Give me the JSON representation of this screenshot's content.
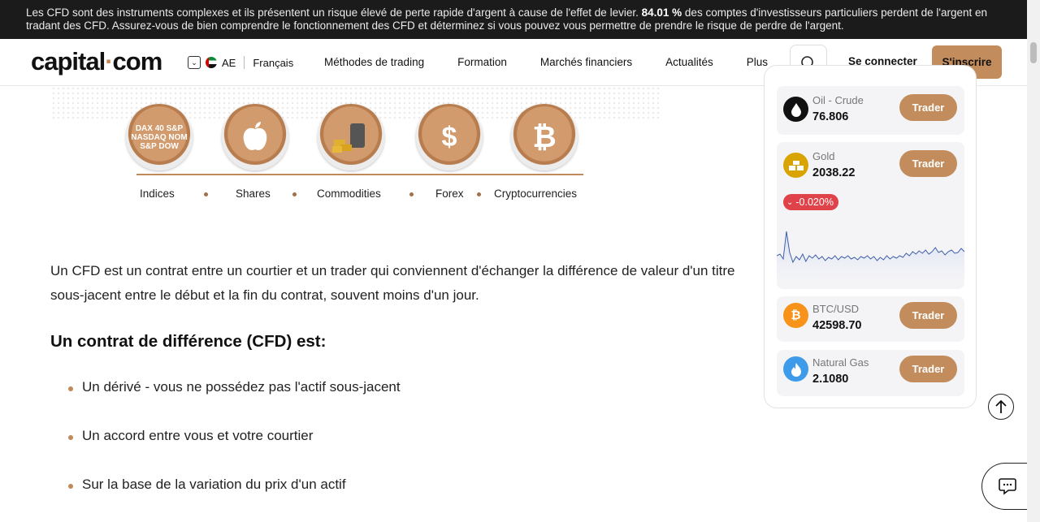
{
  "risk_banner": {
    "text_before": "Les CFD sont des instruments complexes et ils présentent un risque élevé de perte rapide d'argent à cause de l'effet de levier.",
    "percent": "84.01 %",
    "text_after": "des comptes d'investisseurs particuliers perdent de l'argent en tradant des CFD. Assurez-vous de bien comprendre le fonctionnement des CFD et déterminez si vous pouvez vous permettre de prendre le risque de perdre de l'argent."
  },
  "header": {
    "logo_part1": "capital",
    "logo_dot": "·",
    "logo_part2": "com",
    "region_code": "AE",
    "language": "Français",
    "nav": [
      "Méthodes de trading",
      "Formation",
      "Marchés financiers",
      "Actualités",
      "Plus"
    ],
    "login_label": "Se connecter",
    "signup_label": "S'inscrire",
    "search_icon": "search-icon"
  },
  "hero_image": {
    "categories": [
      "Indices",
      "Shares",
      "Commodities",
      "Forex",
      "Cryptocurrencies"
    ],
    "indices_badge_text": "DAX 40 S&P\nNASDAQ NOM\nS&P DOW"
  },
  "article": {
    "paragraph": "Un CFD est un contrat entre un courtier et un trader qui conviennent d'échanger la différence de valeur d'un titre sous-jacent entre le début et la fin du contrat, souvent moins d'un jour.",
    "heading": "Un contrat de différence (CFD) est:",
    "bullets": [
      "Un dérivé - vous ne possédez pas l'actif sous-jacent",
      "Un accord entre vous et votre courtier",
      "Sur la base de la variation du prix d'un actif"
    ]
  },
  "sidebar": {
    "trade_label": "Trader",
    "assets": [
      {
        "name": "Oil - Crude",
        "price": "76.806",
        "icon": "oil-drop-icon",
        "color": "#111111"
      },
      {
        "name": "Gold",
        "price": "2038.22",
        "icon": "gold-bars-icon",
        "color": "#d9a400",
        "change": "-0.020%"
      },
      {
        "name": "BTC/USD",
        "price": "42598.70",
        "icon": "bitcoin-icon",
        "color": "#f7931a"
      },
      {
        "name": "Natural Gas",
        "price": "2.1080",
        "icon": "flame-icon",
        "color": "#3d9be9"
      }
    ],
    "change_color": "#e0424a",
    "gold_sparkline": [
      40,
      38,
      44,
      10,
      36,
      48,
      41,
      45,
      38,
      47,
      40,
      43,
      39,
      44,
      41,
      46,
      42,
      44,
      40,
      45,
      41,
      43,
      40,
      44,
      42,
      45,
      41,
      43,
      40,
      44,
      41,
      46,
      42,
      45,
      40,
      44,
      41,
      43,
      40,
      42,
      37,
      40,
      35,
      38,
      34,
      37,
      33,
      38,
      35,
      30,
      36,
      34,
      39,
      35,
      33,
      37,
      36,
      31,
      35
    ]
  },
  "accent_color": "#c28c5c"
}
